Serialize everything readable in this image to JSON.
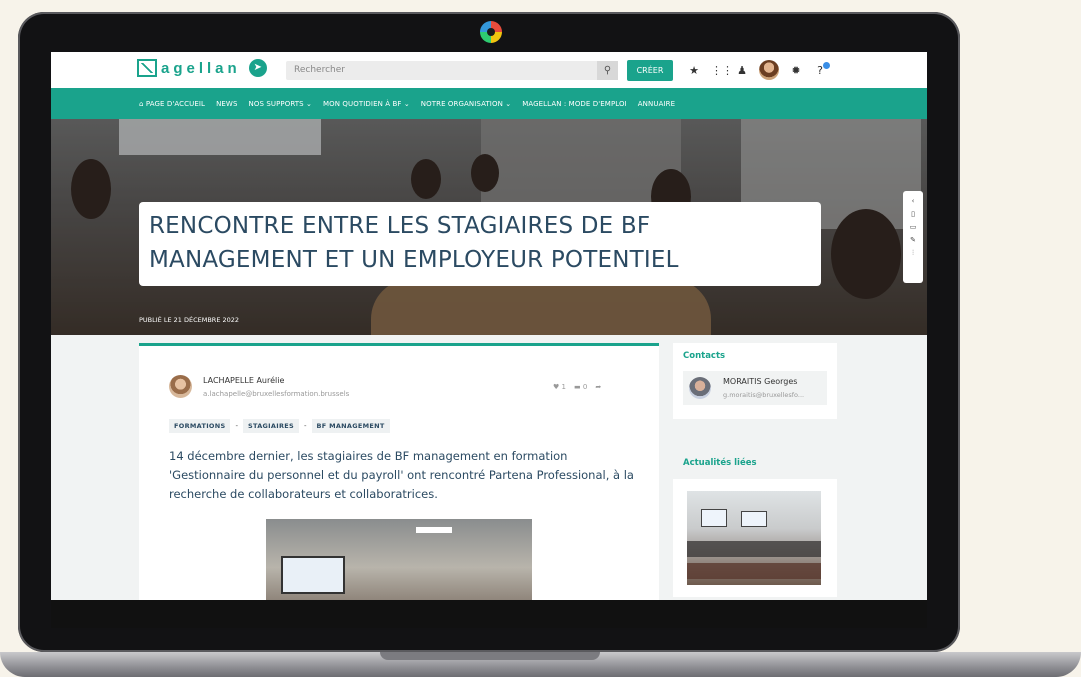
{
  "topbar": {
    "logo_text": "agellan",
    "search_placeholder": "Rechercher",
    "create_label": "CRÉER"
  },
  "nav": {
    "items": [
      "PAGE D'ACCUEIL",
      "NEWS",
      "NOS SUPPORTS",
      "MON QUOTIDIEN À BF",
      "NOTRE ORGANISATION",
      "MAGELLAN : MODE D'EMPLOI",
      "ANNUAIRE"
    ]
  },
  "hero": {
    "title": "RENCONTRE ENTRE LES STAGIAIRES DE BF MANAGEMENT ET UN EMPLOYEUR POTENTIEL",
    "date": "PUBLIÉ LE 21 DÉCEMBRE 2022"
  },
  "article": {
    "author_name": "LACHAPELLE Aurélie",
    "author_email": "a.lachapelle@bruxellesformation.brussels",
    "likes": "1",
    "comments": "0",
    "tags": [
      "FORMATIONS",
      "STAGIAIRES",
      "BF MANAGEMENT"
    ],
    "tag_separator": "-",
    "body": "14 décembre dernier, les stagiaires de BF management en formation 'Gestionnaire du personnel et du payroll' ont rencontré Partena Professional, à la recherche de collaborateurs et collaboratrices."
  },
  "sidebar": {
    "contacts_title": "Contacts",
    "contact_name": "MORAITIS Georges",
    "contact_email": "g.moraitis@bruxellesfo...",
    "related_title": "Actualités liées"
  },
  "colors": {
    "accent": "#1aa38c",
    "title_text": "#2b4a62"
  }
}
